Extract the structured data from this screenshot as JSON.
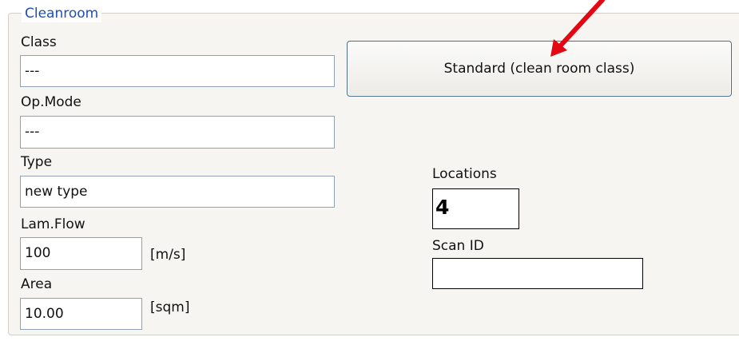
{
  "group": {
    "title": "Cleanroom"
  },
  "fields": {
    "class": {
      "label": "Class",
      "value": "---"
    },
    "op_mode": {
      "label": "Op.Mode",
      "value": "---"
    },
    "type": {
      "label": "Type",
      "value": "new type"
    },
    "lam_flow": {
      "label": "Lam.Flow",
      "value": "100",
      "unit": "[m/s]"
    },
    "area": {
      "label": "Area",
      "value": "10.00",
      "unit": "[sqm]"
    }
  },
  "standard_button": {
    "label": "Standard (clean room class)"
  },
  "locations": {
    "label": "Locations",
    "value": "4"
  },
  "scan_id": {
    "label": "Scan ID",
    "value": ""
  },
  "annotation": {
    "arrow_color": "#e30613",
    "icon": "red-arrow-icon"
  },
  "colors": {
    "group_title": "#1f4fb4",
    "field_border": "#8fa2b9",
    "button_border": "#4a6a92",
    "panel_background": "#f6f5f1"
  }
}
